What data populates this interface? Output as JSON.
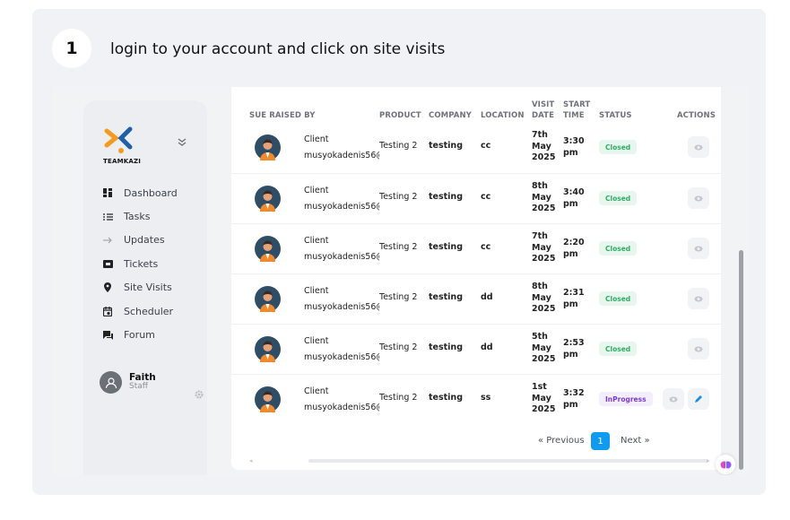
{
  "step": {
    "number": "1",
    "instruction": "login to your account and click on site visits"
  },
  "sidebar": {
    "logo_text": "TEAMKAZI",
    "items": [
      {
        "label": "Dashboard",
        "icon": "dashboard-icon"
      },
      {
        "label": "Tasks",
        "icon": "tasks-icon"
      },
      {
        "label": "Updates",
        "icon": "updates-icon"
      },
      {
        "label": "Tickets",
        "icon": "tickets-icon"
      },
      {
        "label": "Site Visits",
        "icon": "location-pin-icon"
      },
      {
        "label": "Scheduler",
        "icon": "calendar-icon"
      },
      {
        "label": "Forum",
        "icon": "forum-icon"
      }
    ],
    "user": {
      "name": "Faith",
      "role": "Staff"
    }
  },
  "table": {
    "headers": {
      "raised_by": "SUE RAISED BY",
      "product": "PRODUCT",
      "company": "COMPANY",
      "location": "LOCATION",
      "visit_date_1": "VISIT",
      "visit_date_2": "DATE",
      "start_time_1": "START",
      "start_time_2": "TIME",
      "status": "STATUS",
      "actions": "ACTIONS"
    },
    "rows": [
      {
        "client": "Client",
        "email": "musyokadenis56@",
        "product": "Testing 2",
        "company": "testing",
        "location": "cc",
        "date_1": "7th",
        "date_2": "May",
        "date_3": "2025",
        "time_1": "3:30",
        "time_2": "pm",
        "status": "Closed"
      },
      {
        "client": "Client",
        "email": "musyokadenis56@",
        "product": "Testing 2",
        "company": "testing",
        "location": "cc",
        "date_1": "8th",
        "date_2": "May",
        "date_3": "2025",
        "time_1": "3:40",
        "time_2": "pm",
        "status": "Closed"
      },
      {
        "client": "Client",
        "email": "musyokadenis56@",
        "product": "Testing 2",
        "company": "testing",
        "location": "cc",
        "date_1": "7th",
        "date_2": "May",
        "date_3": "2025",
        "time_1": "2:20",
        "time_2": "pm",
        "status": "Closed"
      },
      {
        "client": "Client",
        "email": "musyokadenis56@",
        "product": "Testing 2",
        "company": "testing",
        "location": "dd",
        "date_1": "8th",
        "date_2": "May",
        "date_3": "2025",
        "time_1": "2:31",
        "time_2": "pm",
        "status": "Closed"
      },
      {
        "client": "Client",
        "email": "musyokadenis56@",
        "product": "Testing 2",
        "company": "testing",
        "location": "dd",
        "date_1": "5th",
        "date_2": "May",
        "date_3": "2025",
        "time_1": "2:53",
        "time_2": "pm",
        "status": "Closed"
      },
      {
        "client": "Client",
        "email": "musyokadenis56@",
        "product": "Testing 2",
        "company": "testing",
        "location": "ss",
        "date_1": "1st",
        "date_2": "May",
        "date_3": "2025",
        "time_1": "3:32",
        "time_2": "pm",
        "status": "InProgress"
      }
    ]
  },
  "pagination": {
    "previous": "« Previous",
    "current": "1",
    "next": "Next »"
  },
  "colors": {
    "accent": "#119bf0",
    "closed": "#2fae63",
    "inprogress": "#7a3ec5"
  }
}
